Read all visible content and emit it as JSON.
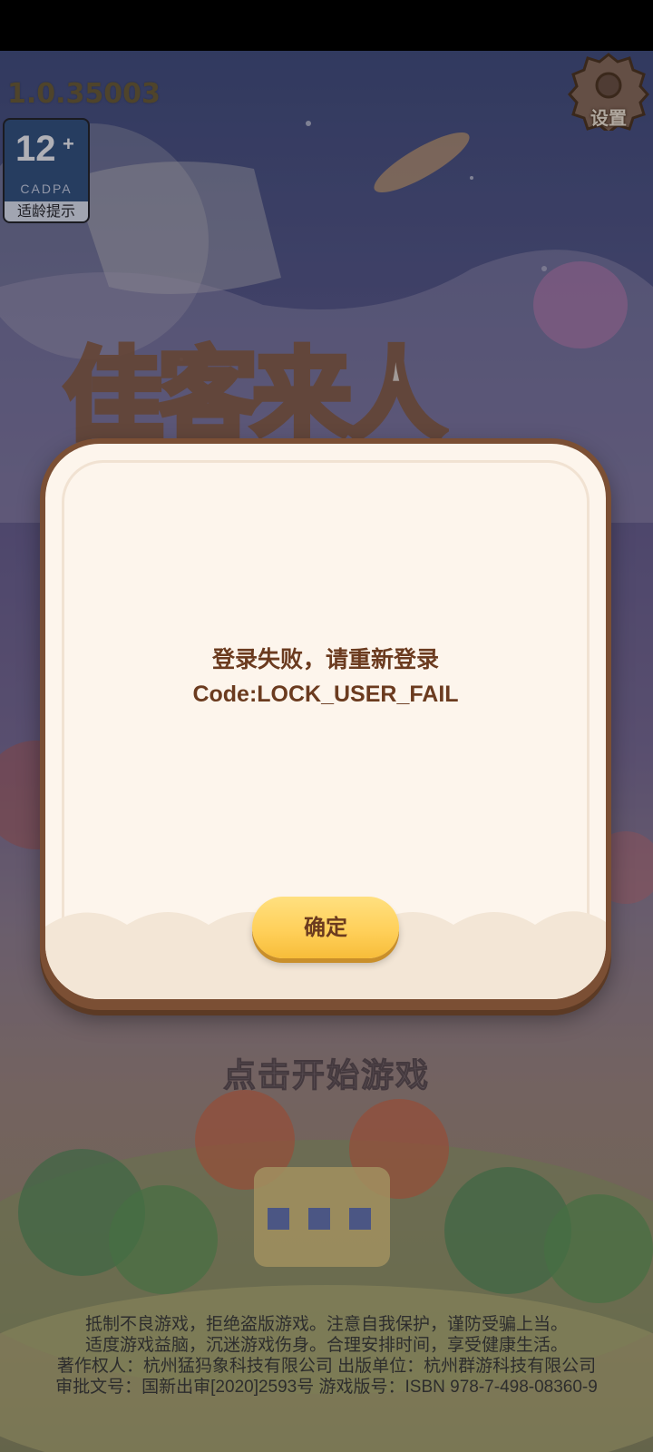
{
  "app": {
    "version": "1.0.35003",
    "settings_label": "设置",
    "age_rating": {
      "number": "12",
      "plus": "+",
      "org": "CADPA",
      "tip": "适龄提示"
    },
    "start_prompt": "点击开始游戏"
  },
  "dialog": {
    "message_line1": "登录失败，请重新登录",
    "message_line2": "Code:LOCK_USER_FAIL",
    "ok_label": "确定"
  },
  "footer": {
    "lines": [
      "抵制不良游戏，拒绝盗版游戏。注意自我保护，谨防受骗上当。",
      "适度游戏益脑，沉迷游戏伤身。合理安排时间，享受健康生活。",
      "著作权人：杭州猛犸象科技有限公司     出版单位：杭州群游科技有限公司",
      "审批文号：国新出审[2020]2593号     游戏版号：ISBN 978-7-498-08360-9"
    ]
  },
  "colors": {
    "dialog_border": "#7b4f34",
    "dialog_fill": "#fdf5ec",
    "text_brown": "#6b3b1f",
    "button_yellow": "#ffd05a"
  },
  "icons": [
    "gear-icon"
  ]
}
